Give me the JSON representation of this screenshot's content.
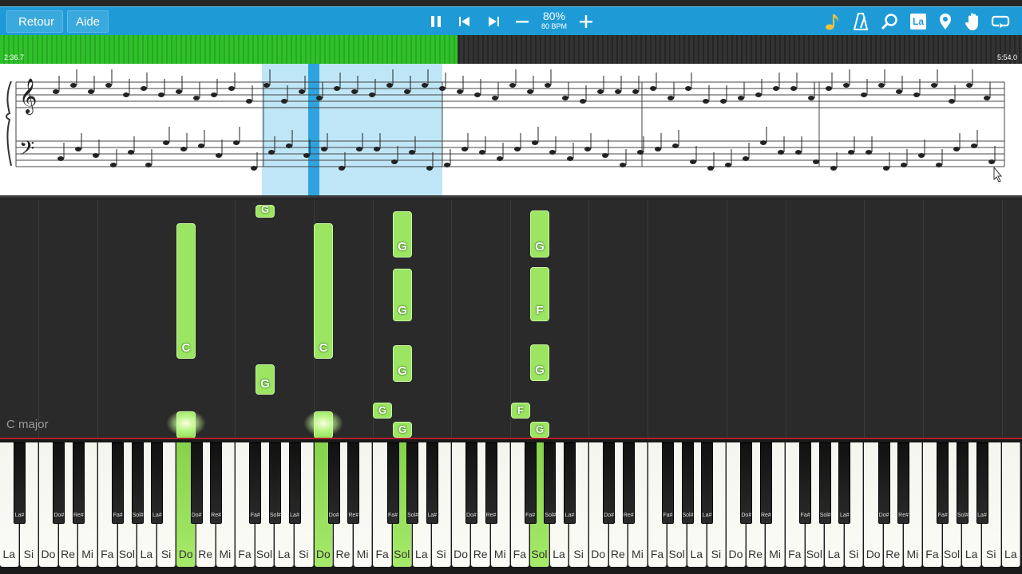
{
  "toolbar": {
    "back_label": "Retour",
    "help_label": "Aide",
    "tempo_percent": "80%",
    "tempo_bpm": "80 BPM",
    "icons": [
      "pause-icon",
      "skip-back-icon",
      "skip-forward-icon",
      "minus-icon",
      "plus-icon",
      "note-icon",
      "metronome-icon",
      "zoom-icon",
      "note-names-icon",
      "location-icon",
      "hand-icon",
      "loop-icon"
    ],
    "note_names_label": "La",
    "accent": "#1e9bd7"
  },
  "progress": {
    "current": "2:36.7",
    "total": "5:54.0",
    "fraction": 0.4477,
    "fill_color": "#2fc12a"
  },
  "score": {
    "highlight_color": "#bfe6f7"
  },
  "notes_area": {
    "key_signature": "C major",
    "note_color": "#9be562",
    "notes": [
      {
        "label": "G"
      },
      {
        "label": "C"
      },
      {
        "label": "G"
      },
      {
        "label": "C"
      },
      {
        "label": "G"
      },
      {
        "label": "G"
      },
      {
        "label": "G"
      },
      {
        "label": "G"
      },
      {
        "label": "F"
      },
      {
        "label": "G"
      },
      {
        "label": "G"
      },
      {
        "label": "G"
      },
      {
        "label": "G"
      },
      {
        "label": "F"
      },
      {
        "label": "G"
      }
    ]
  },
  "keyboard": {
    "white_keys": [
      "La",
      "Si",
      "Do",
      "Re",
      "Mi",
      "Fa",
      "Sol",
      "La",
      "Si",
      "Do",
      "Re",
      "Mi",
      "Fa",
      "Sol",
      "La",
      "Si",
      "Do",
      "Re",
      "Mi",
      "Fa",
      "Sol",
      "La",
      "Si",
      "Do",
      "Re",
      "Mi",
      "Fa",
      "Sol",
      "La",
      "Si",
      "Do",
      "Re",
      "Mi",
      "Fa",
      "Sol",
      "La",
      "Si",
      "Do",
      "Re",
      "Mi",
      "Fa",
      "Sol",
      "La",
      "Si",
      "Do",
      "Re",
      "Mi",
      "Fa",
      "Sol",
      "La",
      "Si",
      "La"
    ],
    "black_labels": [
      "La#",
      "Do#",
      "Re#",
      "Fa#",
      "Sol#"
    ],
    "active_color": "#9be562"
  }
}
